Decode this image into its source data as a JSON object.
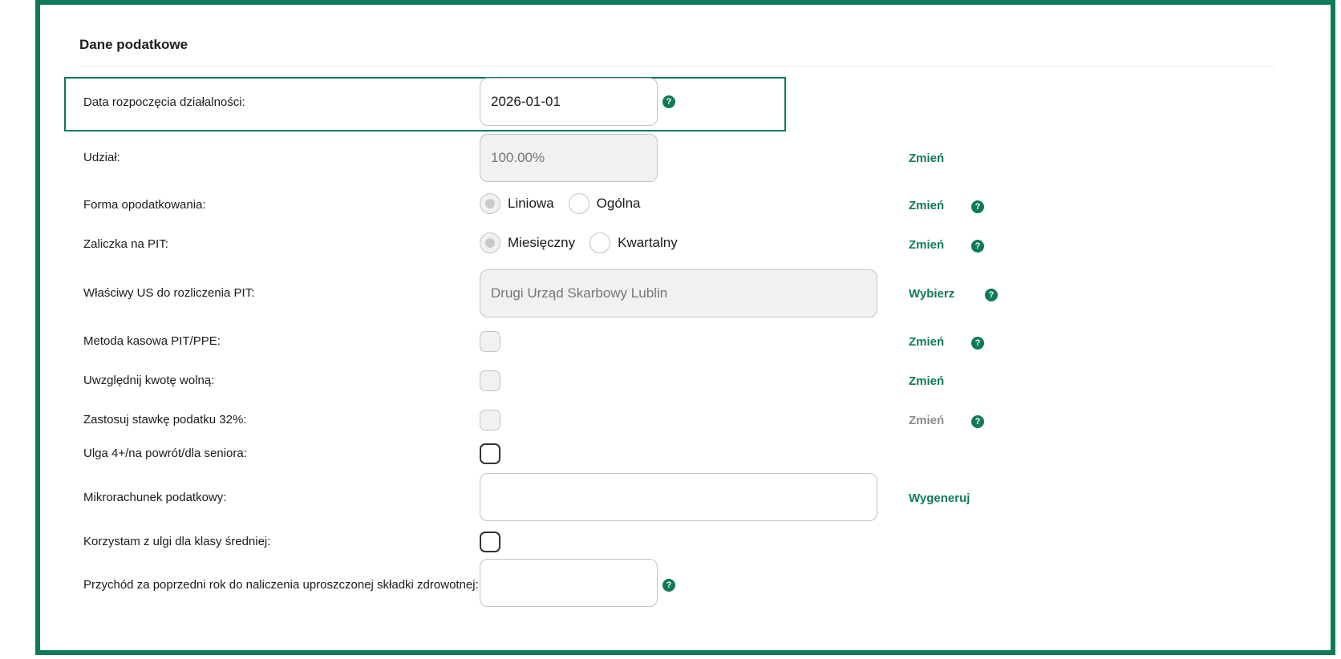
{
  "section": {
    "title": "Dane podatkowe"
  },
  "start_date": {
    "label": "Data rozpoczęcia działalności:",
    "value": "2026-01-01"
  },
  "share": {
    "label": "Udział:",
    "value": "100.00%",
    "action": "Zmień"
  },
  "tax_form": {
    "label": "Forma opodatkowania:",
    "options": [
      "Liniowa",
      "Ogólna"
    ],
    "selected": "Liniowa",
    "action": "Zmień"
  },
  "pit_advance": {
    "label": "Zaliczka na PIT:",
    "options": [
      "Miesięczny",
      "Kwartalny"
    ],
    "selected": "Miesięczny",
    "action": "Zmień"
  },
  "tax_office": {
    "label": "Właściwy US do rozliczenia PIT:",
    "value": "Drugi Urząd Skarbowy Lublin",
    "action": "Wybierz"
  },
  "cash_method": {
    "label": "Metoda kasowa PIT/PPE:",
    "action": "Zmień"
  },
  "tax_free": {
    "label": "Uwzględnij kwotę wolną:",
    "action": "Zmień"
  },
  "rate32": {
    "label": "Zastosuj stawkę podatku 32%:",
    "action": "Zmień"
  },
  "relief": {
    "label": "Ulga 4+/na powrót/dla seniora:"
  },
  "microaccount": {
    "label": "Mikrorachunek podatkowy:",
    "value": "",
    "action": "Wygeneruj"
  },
  "middle_class": {
    "label": "Korzystam z ulgi dla klasy średniej:"
  },
  "prev_income": {
    "label": "Przychód za poprzedni rok do naliczenia uproszczonej składki zdrowotnej:",
    "value": ""
  },
  "help_glyph": "?",
  "colors": {
    "accent": "#0f7a5a",
    "disabled_bg": "#f1f1f1"
  }
}
